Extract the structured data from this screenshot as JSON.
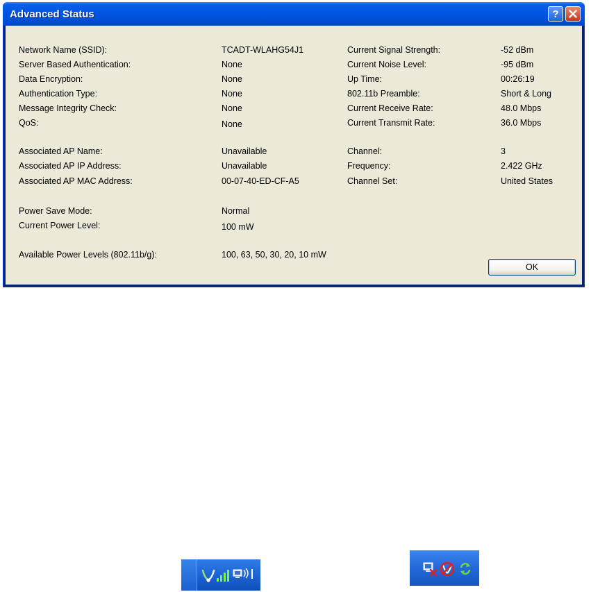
{
  "dialog": {
    "title": "Advanced Status",
    "help_label": "?",
    "ok_label": "OK"
  },
  "left_rows": [
    {
      "label": "Network Name (SSID):",
      "value": "TCADT-WLAHG54J1"
    },
    {
      "label": "Server Based Authentication:",
      "value": "None"
    },
    {
      "label": "Data Encryption:",
      "value": "None"
    },
    {
      "label": "Authentication Type:",
      "value": "None"
    },
    {
      "label": "Message Integrity Check:",
      "value": "None"
    },
    {
      "label": "QoS:",
      "value": "None"
    },
    {
      "label": "Associated AP Name:",
      "value": "Unavailable"
    },
    {
      "label": "Associated AP IP Address:",
      "value": "Unavailable"
    },
    {
      "label": "Associated AP MAC Address:",
      "value": "00-07-40-ED-CF-A5"
    },
    {
      "label": "Power Save Mode:",
      "value": "Normal"
    },
    {
      "label": "Current Power Level:",
      "value": "100 mW"
    },
    {
      "label": "Available Power Levels (802.11b/g):",
      "value": "100, 63, 50, 30, 20, 10 mW"
    }
  ],
  "right_rows": [
    {
      "label": "Current Signal Strength:",
      "value": "-52 dBm"
    },
    {
      "label": "Current Noise Level:",
      "value": "-95 dBm"
    },
    {
      "label": "Up Time:",
      "value": "00:26:19"
    },
    {
      "label": "802.11b Preamble:",
      "value": "Short & Long"
    },
    {
      "label": "Current Receive Rate:",
      "value": "48.0 Mbps"
    },
    {
      "label": "Current Transmit Rate:",
      "value": "36.0 Mbps"
    },
    {
      "label": "Channel:",
      "value": "3"
    },
    {
      "label": "Frequency:",
      "value": "2.422 GHz"
    },
    {
      "label": "Channel Set:",
      "value": "United States"
    }
  ],
  "tray_connected": {
    "icons": [
      "wireless-utility-icon",
      "signal-bars-icon",
      "network-computer-icon"
    ]
  },
  "tray_disconnected": {
    "icons": [
      "network-disconnected-icon",
      "no-wireless-icon",
      "refresh-arrows-icon"
    ]
  },
  "colors": {
    "titlebar": "#0155E3",
    "dialog_bg": "#ECE9D8",
    "close_button": "#C6381C",
    "taskbar": "#1E64D6"
  }
}
